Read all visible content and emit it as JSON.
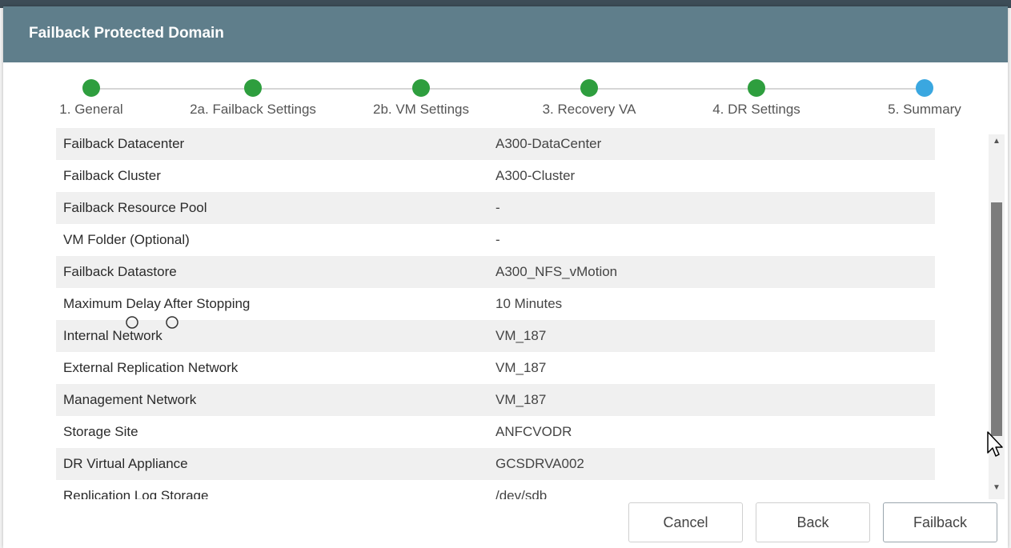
{
  "dialog": {
    "title": "Failback Protected Domain"
  },
  "steps": [
    {
      "label": "1. General",
      "status": "complete"
    },
    {
      "label": "2a. Failback Settings",
      "status": "complete"
    },
    {
      "label": "2b. VM Settings",
      "status": "complete"
    },
    {
      "label": "3. Recovery VA",
      "status": "complete"
    },
    {
      "label": "4. DR Settings",
      "status": "complete"
    },
    {
      "label": "5. Summary",
      "status": "current"
    }
  ],
  "summary": {
    "rows": [
      {
        "key": "Failback Datacenter",
        "value": "A300-DataCenter"
      },
      {
        "key": "Failback Cluster",
        "value": "A300-Cluster"
      },
      {
        "key": "Failback Resource Pool",
        "value": "-"
      },
      {
        "key": "VM Folder (Optional)",
        "value": "-"
      },
      {
        "key": "Failback Datastore",
        "value": "A300_NFS_vMotion"
      },
      {
        "key": "Maximum Delay After Stopping",
        "value": "10 Minutes"
      },
      {
        "key": "Internal Network",
        "value": "VM_187"
      },
      {
        "key": "External Replication Network",
        "value": "VM_187"
      },
      {
        "key": "Management Network",
        "value": "VM_187"
      },
      {
        "key": "Storage Site",
        "value": "ANFCVODR"
      },
      {
        "key": "DR Virtual Appliance",
        "value": "GCSDRVA002"
      },
      {
        "key": "Replication Log Storage",
        "value": "/dev/sdb"
      }
    ]
  },
  "buttons": {
    "cancel": "Cancel",
    "back": "Back",
    "failback": "Failback"
  },
  "colors": {
    "titlebar": "#5f7e8b",
    "step_complete": "#2e9e3e",
    "step_current": "#3aa7e0"
  }
}
